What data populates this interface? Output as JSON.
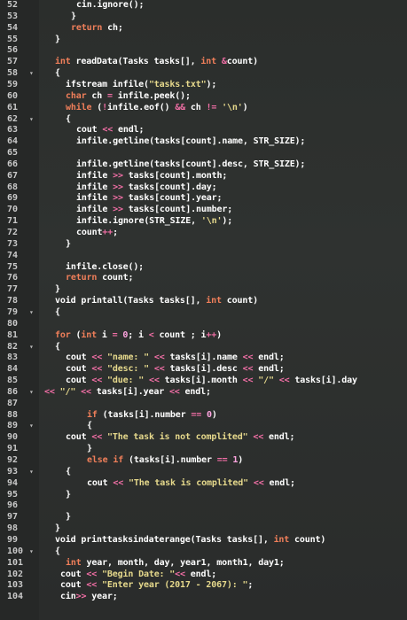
{
  "editor": {
    "lines": [
      {
        "n": "52",
        "fold": false,
        "indent": 6,
        "t": [
          [
            "cin.ignore();",
            ""
          ]
        ]
      },
      {
        "n": "53",
        "fold": false,
        "indent": 5,
        "t": [
          [
            "}",
            ""
          ]
        ]
      },
      {
        "n": "54",
        "fold": false,
        "indent": 5,
        "t": [
          [
            "return",
            "kw"
          ],
          [
            " ch;",
            ""
          ]
        ]
      },
      {
        "n": "55",
        "fold": false,
        "indent": 2,
        "t": [
          [
            "}",
            ""
          ]
        ]
      },
      {
        "n": "56",
        "fold": false,
        "indent": 0,
        "t": []
      },
      {
        "n": "57",
        "fold": false,
        "indent": 2,
        "t": [
          [
            "int",
            "kw"
          ],
          [
            " readData(Tasks tasks[], ",
            ""
          ],
          [
            "int",
            "kw"
          ],
          [
            " ",
            ""
          ],
          [
            "&",
            "op"
          ],
          [
            "count)",
            ""
          ]
        ]
      },
      {
        "n": "58",
        "fold": true,
        "indent": 2,
        "t": [
          [
            "{",
            ""
          ]
        ]
      },
      {
        "n": "59",
        "fold": false,
        "indent": 4,
        "t": [
          [
            "ifstream infile(",
            ""
          ],
          [
            "\"tasks.txt\"",
            "st"
          ],
          [
            ");",
            ""
          ]
        ]
      },
      {
        "n": "60",
        "fold": false,
        "indent": 4,
        "t": [
          [
            "char",
            "kw"
          ],
          [
            " ch ",
            ""
          ],
          [
            "=",
            "op"
          ],
          [
            " infile.peek();",
            ""
          ]
        ]
      },
      {
        "n": "61",
        "fold": false,
        "indent": 4,
        "t": [
          [
            "while",
            "kw"
          ],
          [
            " (",
            ""
          ],
          [
            "!",
            "op"
          ],
          [
            "infile.eof() ",
            ""
          ],
          [
            "&&",
            "op"
          ],
          [
            " ch ",
            ""
          ],
          [
            "!=",
            "op"
          ],
          [
            " ",
            ""
          ],
          [
            "'\\n'",
            "st"
          ],
          [
            ")",
            ""
          ]
        ]
      },
      {
        "n": "62",
        "fold": true,
        "indent": 4,
        "t": [
          [
            "{",
            ""
          ]
        ]
      },
      {
        "n": "63",
        "fold": false,
        "indent": 6,
        "t": [
          [
            "cout ",
            ""
          ],
          [
            "<<",
            "op"
          ],
          [
            " endl;",
            ""
          ]
        ]
      },
      {
        "n": "64",
        "fold": false,
        "indent": 6,
        "t": [
          [
            "infile.getline(tasks[count].name, STR_SIZE);",
            ""
          ]
        ]
      },
      {
        "n": "65",
        "fold": false,
        "indent": 0,
        "t": []
      },
      {
        "n": "66",
        "fold": false,
        "indent": 6,
        "t": [
          [
            "infile.getline(tasks[count].desc, STR_SIZE);",
            ""
          ]
        ]
      },
      {
        "n": "67",
        "fold": false,
        "indent": 6,
        "t": [
          [
            "infile ",
            ""
          ],
          [
            ">>",
            "op"
          ],
          [
            " tasks[count].month;",
            ""
          ]
        ]
      },
      {
        "n": "68",
        "fold": false,
        "indent": 6,
        "t": [
          [
            "infile ",
            ""
          ],
          [
            ">>",
            "op"
          ],
          [
            " tasks[count].day;",
            ""
          ]
        ]
      },
      {
        "n": "69",
        "fold": false,
        "indent": 6,
        "t": [
          [
            "infile ",
            ""
          ],
          [
            ">>",
            "op"
          ],
          [
            " tasks[count].year;",
            ""
          ]
        ]
      },
      {
        "n": "70",
        "fold": false,
        "indent": 6,
        "t": [
          [
            "infile ",
            ""
          ],
          [
            ">>",
            "op"
          ],
          [
            " tasks[count].number;",
            ""
          ]
        ]
      },
      {
        "n": "71",
        "fold": false,
        "indent": 6,
        "t": [
          [
            "infile.ignore(STR_SIZE, ",
            ""
          ],
          [
            "'\\n'",
            "st"
          ],
          [
            ");",
            ""
          ]
        ]
      },
      {
        "n": "72",
        "fold": false,
        "indent": 6,
        "t": [
          [
            "count",
            ""
          ],
          [
            "++",
            "op"
          ],
          [
            ";",
            ""
          ]
        ]
      },
      {
        "n": "73",
        "fold": false,
        "indent": 4,
        "t": [
          [
            "}",
            ""
          ]
        ]
      },
      {
        "n": "74",
        "fold": false,
        "indent": 0,
        "t": []
      },
      {
        "n": "75",
        "fold": false,
        "indent": 4,
        "t": [
          [
            "infile.close();",
            ""
          ]
        ]
      },
      {
        "n": "76",
        "fold": false,
        "indent": 4,
        "t": [
          [
            "return",
            "kw"
          ],
          [
            " count;",
            ""
          ]
        ]
      },
      {
        "n": "77",
        "fold": false,
        "indent": 2,
        "t": [
          [
            "}",
            ""
          ]
        ]
      },
      {
        "n": "78",
        "fold": false,
        "indent": 2,
        "t": [
          [
            "void printall(Tasks tasks[], ",
            ""
          ],
          [
            "int",
            "kw"
          ],
          [
            " count)",
            ""
          ]
        ]
      },
      {
        "n": "79",
        "fold": true,
        "indent": 2,
        "t": [
          [
            "{",
            ""
          ]
        ]
      },
      {
        "n": "80",
        "fold": false,
        "indent": 0,
        "t": []
      },
      {
        "n": "81",
        "fold": false,
        "indent": 2,
        "t": [
          [
            "for",
            "kw"
          ],
          [
            " (",
            ""
          ],
          [
            "int",
            "kw"
          ],
          [
            " i ",
            ""
          ],
          [
            "=",
            "op"
          ],
          [
            " ",
            ""
          ],
          [
            "0",
            "nm"
          ],
          [
            "; i ",
            ""
          ],
          [
            "<",
            "op"
          ],
          [
            " count ; i",
            ""
          ],
          [
            "++",
            "op"
          ],
          [
            ")",
            ""
          ]
        ]
      },
      {
        "n": "82",
        "fold": true,
        "indent": 2,
        "t": [
          [
            "{",
            ""
          ]
        ]
      },
      {
        "n": "83",
        "fold": false,
        "indent": 4,
        "t": [
          [
            "cout ",
            ""
          ],
          [
            "<<",
            "op"
          ],
          [
            " ",
            ""
          ],
          [
            "\"name: \"",
            "st"
          ],
          [
            " ",
            ""
          ],
          [
            "<<",
            "op"
          ],
          [
            " tasks[i].name ",
            ""
          ],
          [
            "<<",
            "op"
          ],
          [
            " endl;",
            ""
          ]
        ]
      },
      {
        "n": "84",
        "fold": false,
        "indent": 4,
        "t": [
          [
            "cout ",
            ""
          ],
          [
            "<<",
            "op"
          ],
          [
            " ",
            ""
          ],
          [
            "\"desc: \"",
            "st"
          ],
          [
            " ",
            ""
          ],
          [
            "<<",
            "op"
          ],
          [
            " tasks[i].desc ",
            ""
          ],
          [
            "<<",
            "op"
          ],
          [
            " endl;",
            ""
          ]
        ]
      },
      {
        "n": "85",
        "fold": false,
        "indent": 4,
        "t": [
          [
            "cout ",
            ""
          ],
          [
            "<<",
            "op"
          ],
          [
            " ",
            ""
          ],
          [
            "\"due: \"",
            "st"
          ],
          [
            " ",
            ""
          ],
          [
            "<<",
            "op"
          ],
          [
            " tasks[i].month ",
            ""
          ],
          [
            "<<",
            "op"
          ],
          [
            " ",
            ""
          ],
          [
            "\"/\"",
            "st"
          ],
          [
            " ",
            ""
          ],
          [
            "<<",
            "op"
          ],
          [
            " tasks[i].day",
            ""
          ]
        ]
      },
      {
        "n": "86",
        "fold": true,
        "indent": 0,
        "t": [
          [
            "<<",
            "op"
          ],
          [
            " ",
            ""
          ],
          [
            "\"/\"",
            "st"
          ],
          [
            " ",
            ""
          ],
          [
            "<<",
            "op"
          ],
          [
            " tasks[i].year ",
            ""
          ],
          [
            "<<",
            "op"
          ],
          [
            " endl;",
            ""
          ]
        ]
      },
      {
        "n": "87",
        "fold": false,
        "indent": 0,
        "t": []
      },
      {
        "n": "88",
        "fold": false,
        "indent": 8,
        "t": [
          [
            "if",
            "kw"
          ],
          [
            " (tasks[i].number ",
            ""
          ],
          [
            "==",
            "op"
          ],
          [
            " ",
            ""
          ],
          [
            "0",
            "nm"
          ],
          [
            ")",
            ""
          ]
        ]
      },
      {
        "n": "89",
        "fold": true,
        "indent": 8,
        "t": [
          [
            "{",
            ""
          ]
        ]
      },
      {
        "n": "90",
        "fold": false,
        "indent": 4,
        "t": [
          [
            "cout ",
            ""
          ],
          [
            "<<",
            "op"
          ],
          [
            " ",
            ""
          ],
          [
            "\"The task is not complited\"",
            "st"
          ],
          [
            " ",
            ""
          ],
          [
            "<<",
            "op"
          ],
          [
            " endl;",
            ""
          ]
        ]
      },
      {
        "n": "91",
        "fold": false,
        "indent": 8,
        "t": [
          [
            "}",
            ""
          ]
        ]
      },
      {
        "n": "92",
        "fold": false,
        "indent": 8,
        "t": [
          [
            "else if",
            "kw"
          ],
          [
            " (tasks[i].number ",
            ""
          ],
          [
            "==",
            "op"
          ],
          [
            " ",
            ""
          ],
          [
            "1",
            "nm"
          ],
          [
            ")",
            ""
          ]
        ]
      },
      {
        "n": "93",
        "fold": true,
        "indent": 4,
        "t": [
          [
            "{",
            ""
          ]
        ]
      },
      {
        "n": "94",
        "fold": false,
        "indent": 8,
        "t": [
          [
            "cout ",
            ""
          ],
          [
            "<<",
            "op"
          ],
          [
            " ",
            ""
          ],
          [
            "\"The task is complited\"",
            "st"
          ],
          [
            " ",
            ""
          ],
          [
            "<<",
            "op"
          ],
          [
            " endl;",
            ""
          ]
        ]
      },
      {
        "n": "95",
        "fold": false,
        "indent": 4,
        "t": [
          [
            "}",
            ""
          ]
        ]
      },
      {
        "n": "96",
        "fold": false,
        "indent": 0,
        "t": []
      },
      {
        "n": "97",
        "fold": false,
        "indent": 4,
        "t": [
          [
            "}",
            ""
          ]
        ]
      },
      {
        "n": "98",
        "fold": false,
        "indent": 2,
        "t": [
          [
            "}",
            ""
          ]
        ]
      },
      {
        "n": "99",
        "fold": false,
        "indent": 2,
        "t": [
          [
            "void printtasksindaterange(Tasks tasks[], ",
            ""
          ],
          [
            "int",
            "kw"
          ],
          [
            " count)",
            ""
          ]
        ]
      },
      {
        "n": "100",
        "fold": true,
        "indent": 2,
        "t": [
          [
            "{",
            ""
          ]
        ]
      },
      {
        "n": "101",
        "fold": false,
        "indent": 4,
        "t": [
          [
            "int",
            "kw"
          ],
          [
            " year, month, day, year1, month1, day1;",
            ""
          ]
        ]
      },
      {
        "n": "102",
        "fold": false,
        "indent": 3,
        "t": [
          [
            "cout ",
            ""
          ],
          [
            "<<",
            "op"
          ],
          [
            " ",
            ""
          ],
          [
            "\"Begin Date: \"",
            "st"
          ],
          [
            "<<",
            "op"
          ],
          [
            " endl;",
            ""
          ]
        ]
      },
      {
        "n": "103",
        "fold": false,
        "indent": 3,
        "t": [
          [
            "cout ",
            ""
          ],
          [
            "<<",
            "op"
          ],
          [
            " ",
            ""
          ],
          [
            "\"Enter year (2017 - 2067): \"",
            "st"
          ],
          [
            ";",
            ""
          ]
        ]
      },
      {
        "n": "104",
        "fold": false,
        "indent": 3,
        "t": [
          [
            "cin",
            ""
          ],
          [
            ">>",
            "op"
          ],
          [
            " year;",
            ""
          ]
        ]
      }
    ]
  }
}
